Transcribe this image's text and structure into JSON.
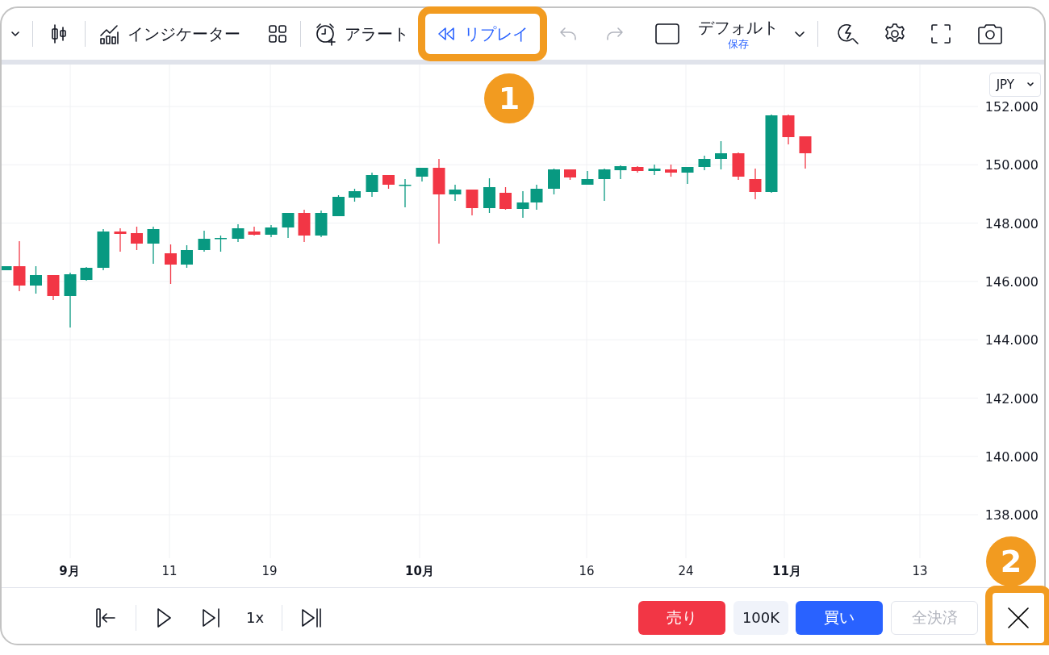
{
  "toolbar": {
    "indicators_label": "インジケーター",
    "alerts_label": "アラート",
    "replay": {
      "label": "リプレイ",
      "highlighted": true
    },
    "undo": {
      "disabled": true
    },
    "redo": {
      "disabled": true
    },
    "layout": {
      "name": "デフォルト",
      "save": "保存"
    }
  },
  "chart": {
    "currency": "JPY",
    "price_axis": [
      "152.000",
      "150.000",
      "148.000",
      "146.000",
      "144.000",
      "142.000",
      "140.000",
      "138.000"
    ],
    "time_axis": [
      {
        "label": "9月",
        "kind": "month"
      },
      {
        "label": "11",
        "kind": "day"
      },
      {
        "label": "19",
        "kind": "day"
      },
      {
        "label": "10月",
        "kind": "month"
      },
      {
        "label": "16",
        "kind": "day"
      },
      {
        "label": "24",
        "kind": "day"
      },
      {
        "label": "11月",
        "kind": "month"
      },
      {
        "label": "13",
        "kind": "day"
      }
    ]
  },
  "playback": {
    "speed": "1x"
  },
  "trade": {
    "sell": "売り",
    "quantity": "100K",
    "buy": "買い",
    "close_all": {
      "label": "全決済",
      "disabled": true
    }
  },
  "close_button": {
    "highlighted": true
  },
  "annotations": [
    {
      "label": "1"
    },
    {
      "label": "2"
    }
  ]
}
